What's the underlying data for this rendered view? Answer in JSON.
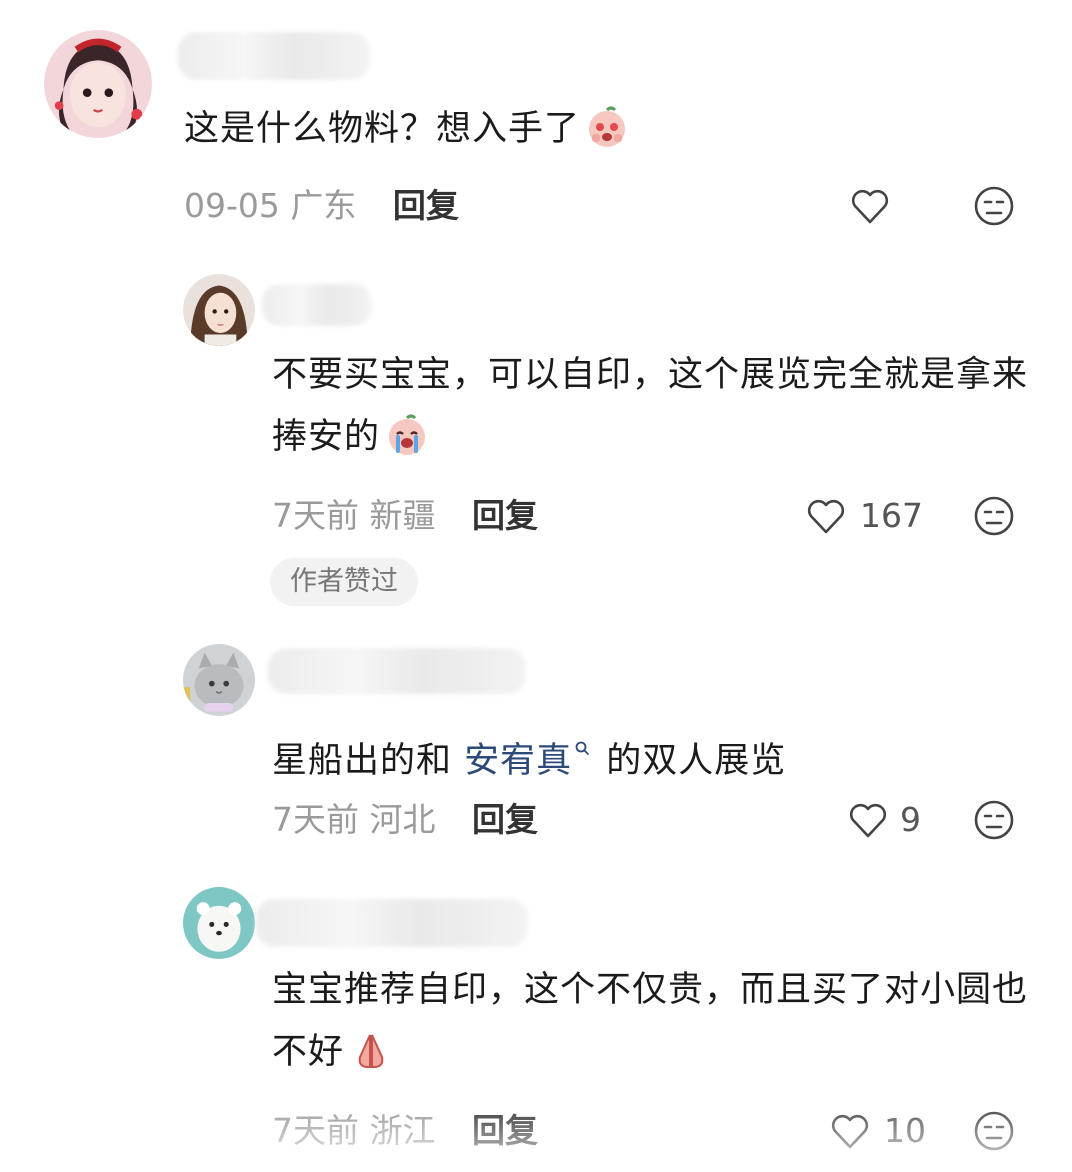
{
  "comments": [
    {
      "text": "这是什么物料？想入手了",
      "time": "09-05",
      "location": "广东",
      "reply_label": "回复",
      "likes": ""
    },
    {
      "text": "不要买宝宝，可以自印，这个展览完全就是拿来捧安的",
      "time": "7天前",
      "location": "新疆",
      "reply_label": "回复",
      "likes": "167",
      "badge": "作者赞过"
    },
    {
      "text_before": "星船出的和 ",
      "mention": "安宥真",
      "text_after": " 的双人展览",
      "time": "7天前",
      "location": "河北",
      "reply_label": "回复",
      "likes": "9"
    },
    {
      "text": "宝宝推荐自印，这个不仅贵，而且买了对小圆也不好",
      "time": "7天前",
      "location": "浙江",
      "reply_label": "回复",
      "likes": "10"
    }
  ],
  "icons": {
    "like": "heart-icon",
    "dislike": "meh-face-icon",
    "emoji_1": "peach-excited-emoji",
    "emoji_2": "peach-crying-emoji",
    "emoji_3": "praying-hands-emoji",
    "search_mark": "search-icon"
  },
  "colors": {
    "mention": "#2b4a78",
    "meta": "#9a9a9a",
    "badge_bg": "#f2f2f2"
  }
}
